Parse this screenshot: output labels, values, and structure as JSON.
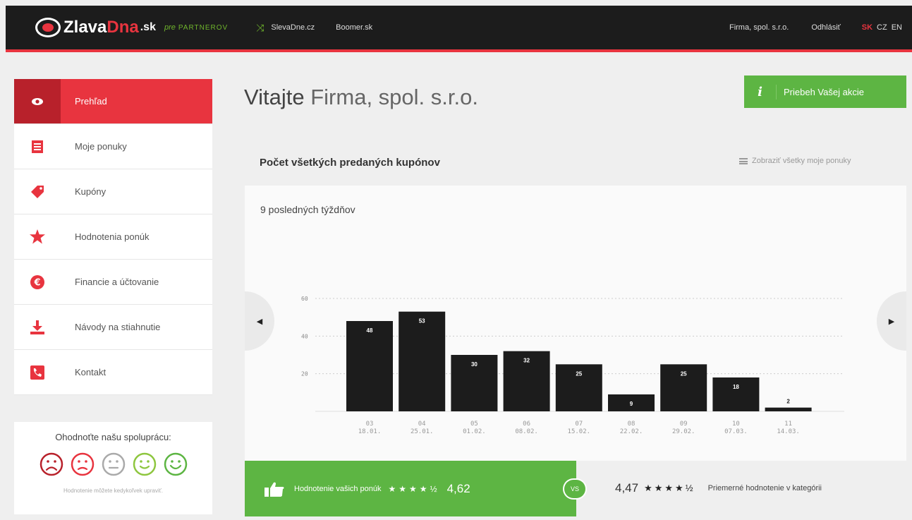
{
  "header": {
    "logo_main": "Zlava",
    "logo_accent": "Dna",
    "logo_tld": ".sk",
    "logo_pre": "pre",
    "logo_partner": "PARTNEROV",
    "links": [
      "SlevaDne.cz",
      "Boomer.sk"
    ],
    "company": "Firma, spol. s.r.o.",
    "logout": "Odhlásiť",
    "languages": [
      "SK",
      "CZ",
      "EN"
    ],
    "active_language": "SK"
  },
  "sidebar": {
    "items": [
      {
        "label": "Prehľad",
        "icon": "eye-icon",
        "active": true
      },
      {
        "label": "Moje ponuky",
        "icon": "list-icon",
        "active": false
      },
      {
        "label": "Kupóny",
        "icon": "tag-icon",
        "active": false
      },
      {
        "label": "Hodnotenia ponúk",
        "icon": "star-icon",
        "active": false
      },
      {
        "label": "Financie a účtovanie",
        "icon": "euro-icon",
        "active": false
      },
      {
        "label": "Návody na stiahnutie",
        "icon": "download-icon",
        "active": false
      },
      {
        "label": "Kontakt",
        "icon": "phone-icon",
        "active": false
      }
    ]
  },
  "rating_box": {
    "title": "Ohodnoťte našu spoluprácu:",
    "faces": [
      {
        "name": "very-sad-face-icon",
        "color": "#b8212b"
      },
      {
        "name": "sad-face-icon",
        "color": "#e8343f"
      },
      {
        "name": "neutral-face-icon",
        "color": "#aaaaaa"
      },
      {
        "name": "happy-face-icon",
        "color": "#8ec63f"
      },
      {
        "name": "very-happy-face-icon",
        "color": "#5db543"
      }
    ],
    "note": "Hodnotenie môžete kedykoľvek upraviť."
  },
  "main": {
    "welcome_word": "Vitajte",
    "welcome_firm": "Firma, spol. s.r.o.",
    "info_button": "Priebeh Vašej akcie",
    "section_title": "Počet všetkých predaných kupónov",
    "show_all": "Zobraziť všetky moje ponuky",
    "chart_subtitle": "9 posledných týždňov"
  },
  "chart_data": {
    "type": "bar",
    "categories": [
      "03|18.01.",
      "04|25.01.",
      "05|01.02.",
      "06|08.02.",
      "07|15.02.",
      "08|22.02.",
      "09|29.02.",
      "10|07.03.",
      "11|14.03."
    ],
    "values": [
      48,
      53,
      30,
      32,
      25,
      9,
      25,
      18,
      2
    ],
    "ylim": [
      0,
      60
    ],
    "yticks": [
      20,
      40,
      60
    ],
    "bar_color": "#1c1c1c",
    "grid": true
  },
  "bottom_rating": {
    "label": "Hodnotenie vašich ponúk",
    "score": "4,62",
    "vs": "VS",
    "category_score": "4,47",
    "category_label": "Priemerné hodnotenie v kategórii"
  },
  "colors": {
    "accent_red": "#e8343f",
    "accent_green": "#5db543",
    "dark": "#1c1c1c"
  }
}
